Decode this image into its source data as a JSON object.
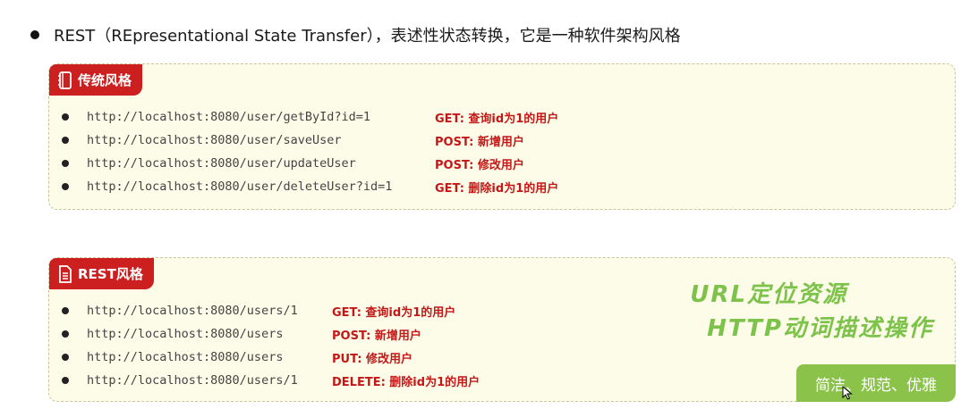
{
  "headline": "REST（REpresentational State Transfer），表述性状态转换，它是一种软件架构风格",
  "traditional": {
    "title": "传统风格",
    "rows": [
      {
        "url": "http://localhost:8080/user/getById?id=1",
        "desc": "GET: 查询id为1的用户"
      },
      {
        "url": "http://localhost:8080/user/saveUser",
        "desc": "POST: 新增用户"
      },
      {
        "url": "http://localhost:8080/user/updateUser",
        "desc": "POST: 修改用户"
      },
      {
        "url": "http://localhost:8080/user/deleteUser?id=1",
        "desc": "GET: 删除id为1的用户"
      }
    ]
  },
  "rest": {
    "title": "REST风格",
    "rows": [
      {
        "url": "http://localhost:8080/users/1",
        "desc": "GET: 查询id为1的用户"
      },
      {
        "url": "http://localhost:8080/users",
        "desc": "POST: 新增用户"
      },
      {
        "url": "http://localhost:8080/users",
        "desc": "PUT: 修改用户"
      },
      {
        "url": "http://localhost:8080/users/1",
        "desc": "DELETE: 删除id为1的用户"
      }
    ],
    "annotation_line1": "URL定位资源",
    "annotation_line2": "HTTP动词描述操作",
    "badge": "简洁、规范、优雅"
  },
  "colors": {
    "accent_red": "#cc1f1f",
    "desc_red": "#c41818",
    "panel_bg": "#fdfce8",
    "annotation_green": "#7dc24a",
    "badge_green": "#8bc34a"
  },
  "icons": [
    "notebook-icon",
    "document-icon",
    "mouse-cursor-icon"
  ]
}
